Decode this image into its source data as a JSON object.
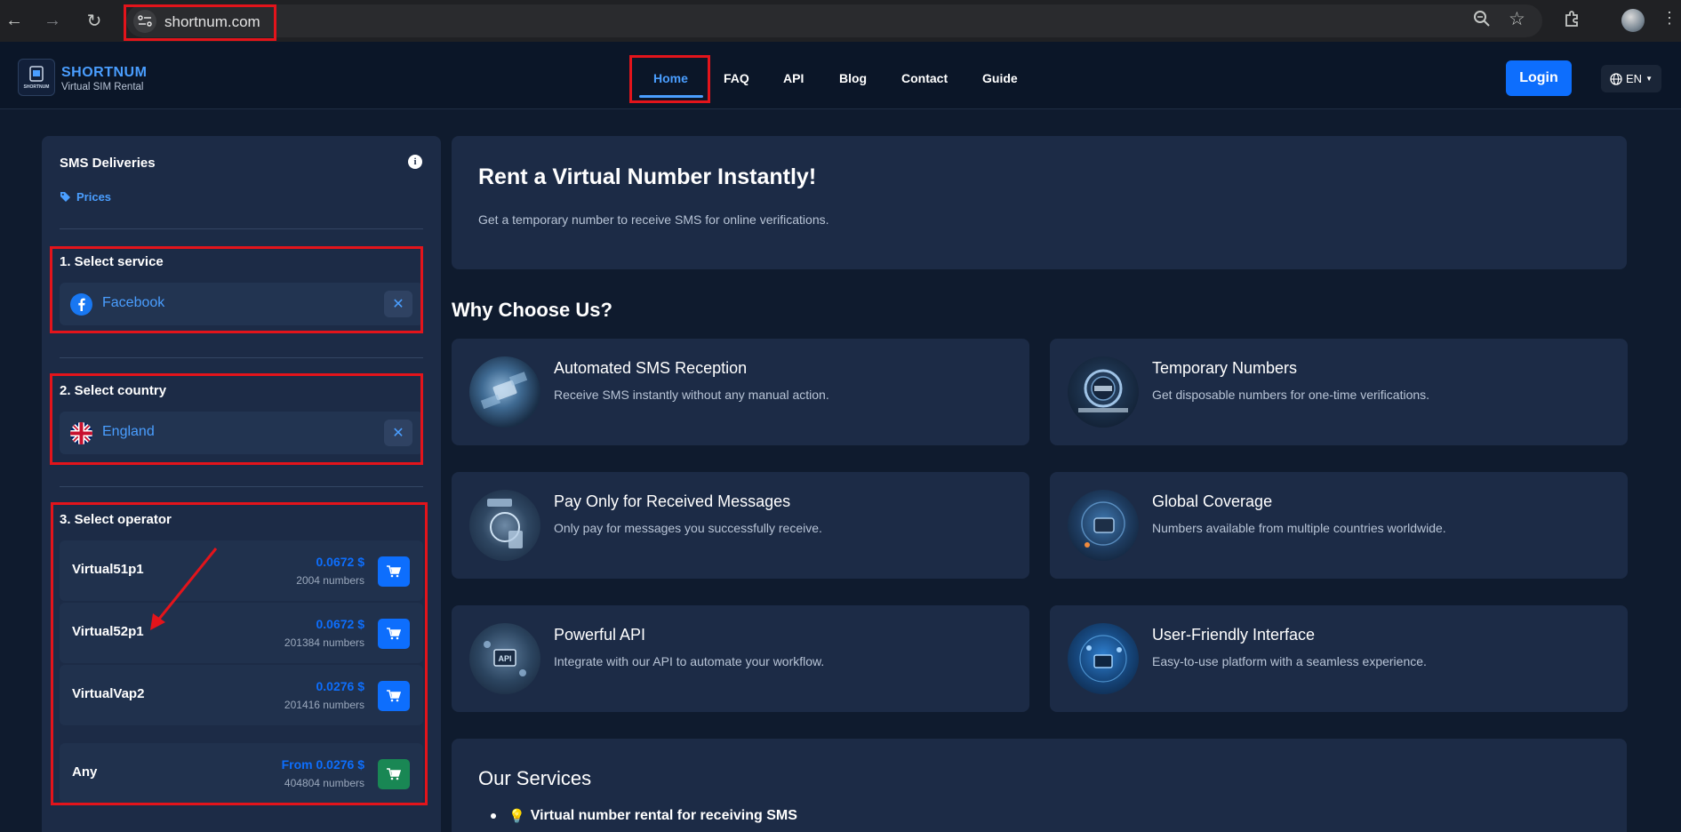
{
  "browser": {
    "url": "shortnum.com"
  },
  "header": {
    "logo_title": "SHORTNUM",
    "logo_subtitle": "Virtual SIM Rental",
    "logo_badge": "SHORTNUM",
    "menu": [
      "Home",
      "FAQ",
      "API",
      "Blog",
      "Contact",
      "Guide"
    ],
    "active_menu": "Home",
    "login_label": "Login",
    "language": "EN"
  },
  "sidebar": {
    "title": "SMS Deliveries",
    "prices_link": "Prices",
    "step1_label": "1. Select service",
    "service_value": "Facebook",
    "step2_label": "2. Select country",
    "country_value": "England",
    "step3_label": "3. Select operator",
    "operators": [
      {
        "name": "Virtual51p1",
        "price": "0.0672 $",
        "count": "2004 numbers"
      },
      {
        "name": "Virtual52p1",
        "price": "0.0672 $",
        "count": "201384 numbers"
      },
      {
        "name": "VirtualVap2",
        "price": "0.0276 $",
        "count": "201416 numbers"
      },
      {
        "name": "Any",
        "price": "From 0.0276 $",
        "count": "404804 numbers"
      }
    ]
  },
  "hero": {
    "title": "Rent a Virtual Number Instantly!",
    "subtitle": "Get a temporary number to receive SMS for online verifications."
  },
  "why": {
    "title": "Why Choose Us?",
    "features": [
      {
        "title": "Automated SMS Reception",
        "desc": "Receive SMS instantly without any manual action.",
        "icon": "chip-icon"
      },
      {
        "title": "Temporary Numbers",
        "desc": "Get disposable numbers for one-time verifications.",
        "icon": "clock-icon"
      },
      {
        "title": "Pay Only for Received Messages",
        "desc": "Only pay for messages you successfully receive.",
        "icon": "refund-icon"
      },
      {
        "title": "Global Coverage",
        "desc": "Numbers available from multiple countries worldwide.",
        "icon": "globe-phone-icon"
      },
      {
        "title": "Powerful API",
        "desc": "Integrate with our API to automate your workflow.",
        "icon": "api-icon"
      },
      {
        "title": "User-Friendly Interface",
        "desc": "Easy-to-use platform with a seamless experience.",
        "icon": "interface-icon"
      }
    ]
  },
  "services": {
    "title": "Our Services",
    "item1": "Virtual number rental for receiving SMS"
  },
  "colors": {
    "accent": "#4a9eff",
    "primary_button": "#0d6efd",
    "any_button": "#198754",
    "highlight": "#e3141b"
  }
}
